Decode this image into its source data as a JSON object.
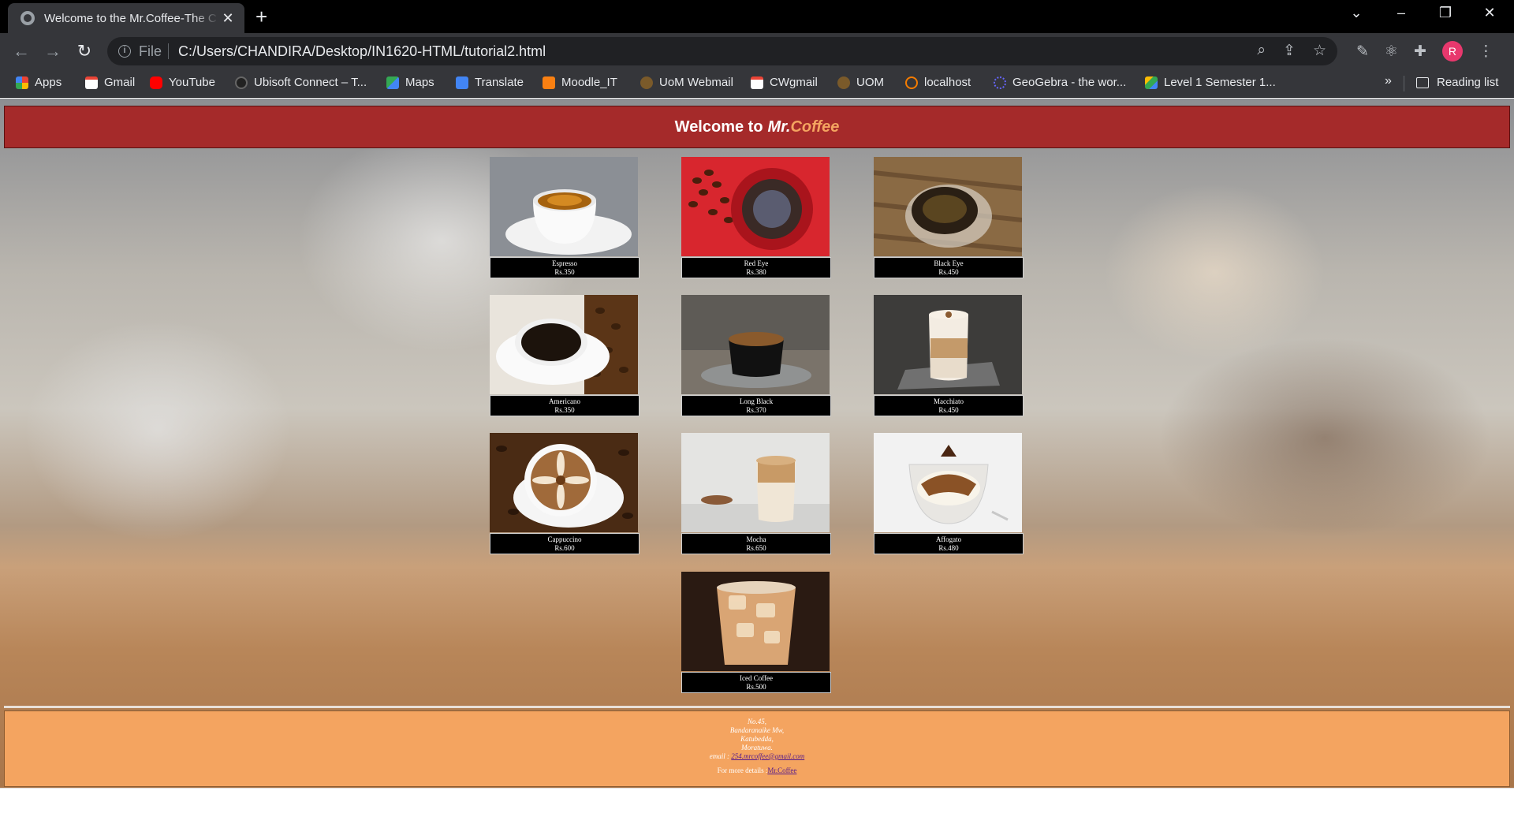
{
  "browser": {
    "tab_title": "Welcome to the Mr.Coffee-The C",
    "url_scheme": "File",
    "url": "C:/Users/CHANDIRA/Desktop/IN1620-HTML/tutorial2.html",
    "profile_initial": "R",
    "bookmarks": [
      "Apps",
      "Gmail",
      "YouTube",
      "Ubisoft Connect – T...",
      "Maps",
      "Translate",
      "Moodle_IT",
      "UoM Webmail",
      "CWgmail",
      "UOM",
      "localhost",
      "GeoGebra - the wor...",
      "Level 1 Semester 1..."
    ],
    "bookmarks_overflow": "»",
    "reading_list": "Reading list"
  },
  "page": {
    "banner_prefix": "Welcome to",
    "banner_brand_mr": "Mr.",
    "banner_brand_coffee": "Coffee",
    "items": [
      {
        "name": "Espresso",
        "price": "Rs.350"
      },
      {
        "name": "Red Eye",
        "price": "Rs.380"
      },
      {
        "name": "Black Eye",
        "price": "Rs.450"
      },
      {
        "name": "Americano",
        "price": "Rs.350"
      },
      {
        "name": "Long Black",
        "price": "Rs.370"
      },
      {
        "name": "Macchiato",
        "price": "Rs.450"
      },
      {
        "name": "Cappuccino",
        "price": "Rs.600"
      },
      {
        "name": "Mocha",
        "price": "Rs.650"
      },
      {
        "name": "Affogato",
        "price": "Rs.480"
      },
      {
        "name": "Iced Coffee",
        "price": "Rs.500"
      }
    ],
    "footer": {
      "address_lines": [
        "No.45,",
        "Bandaranaike Mw,",
        "Katubedda,",
        "Moratuwa."
      ],
      "email_label": "email :",
      "email": "254.mrcoffee@gmail.com",
      "more_label": "For more details :",
      "more_link": "Mr.Coffee"
    }
  }
}
